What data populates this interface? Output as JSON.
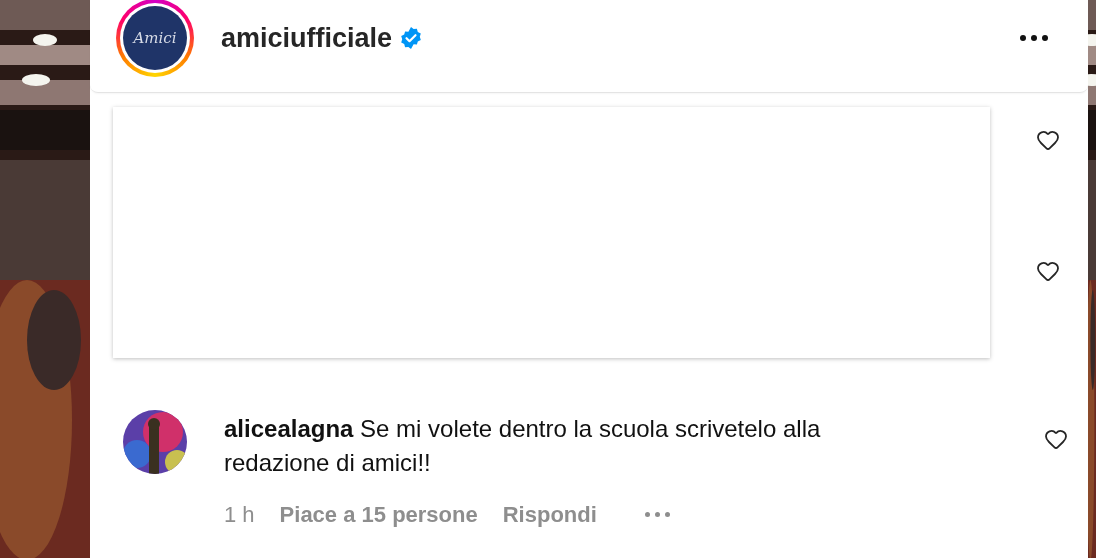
{
  "header": {
    "avatar_logo": "Amici",
    "username": "amiciufficiale",
    "verified": true
  },
  "card_hearts": [
    {
      "liked": false
    },
    {
      "liked": false
    }
  ],
  "comment": {
    "username": "alicealagna",
    "text": "Se mi volete dentro la scuola scrivetelo alla redazione di amici!!",
    "time": "1 h",
    "likes": "Piace a 15 persone",
    "reply": "Rispondi",
    "liked": false
  }
}
